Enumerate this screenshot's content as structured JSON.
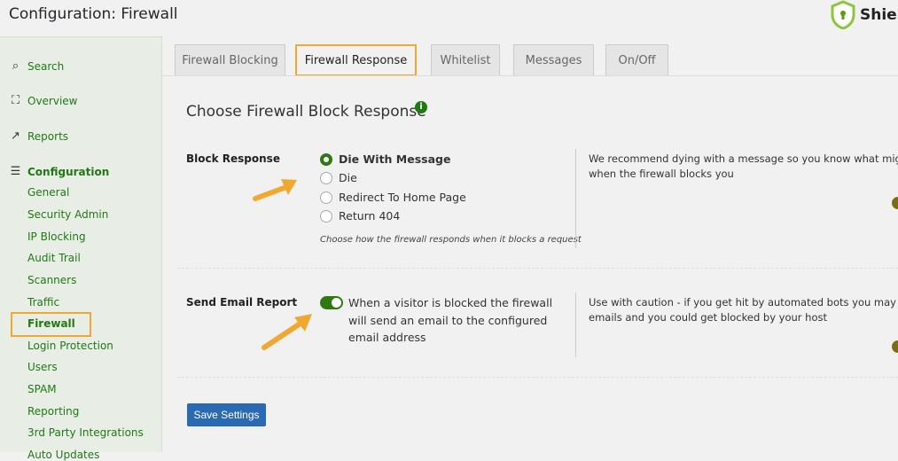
{
  "header": {
    "title": "Configuration: Firewall",
    "brand": "Shield"
  },
  "sidebar": {
    "top": [
      {
        "label": "Search",
        "icon": "search-icon"
      },
      {
        "label": "Overview",
        "icon": "binoculars-icon"
      },
      {
        "label": "Reports",
        "icon": "chart-icon"
      },
      {
        "label": "Configuration",
        "icon": "sliders-icon"
      }
    ],
    "sub": [
      "General",
      "Security Admin",
      "IP Blocking",
      "Audit Trail",
      "Scanners",
      "Traffic",
      "Firewall",
      "Login Protection",
      "Users",
      "SPAM",
      "Reporting",
      "3rd Party Integrations",
      "Auto Updates"
    ]
  },
  "tabs": [
    "Firewall Blocking",
    "Firewall Response",
    "Whitelist",
    "Messages",
    "On/Off"
  ],
  "section": {
    "title": "Choose Firewall Block Response"
  },
  "block_response": {
    "label": "Block Response",
    "options": [
      "Die With Message",
      "Die",
      "Redirect To Home Page",
      "Return 404"
    ],
    "selected": "Die With Message",
    "help": "Choose how the firewall responds when it blocks a request",
    "description": [
      "We recommend dying with a message so you know what might ha",
      "when the firewall blocks you"
    ]
  },
  "email_report": {
    "label": "Send Email Report",
    "enabled": true,
    "text": "When a visitor is blocked the firewall will send an email to the configured email address",
    "description": [
      "Use with caution - if you get hit by automated bots you may send",
      "emails and you could get blocked by your host"
    ]
  },
  "save_label": "Save Settings",
  "colors": {
    "accent": "#1f7a12",
    "highlight": "#f0a830",
    "button": "#2a6ab3"
  }
}
